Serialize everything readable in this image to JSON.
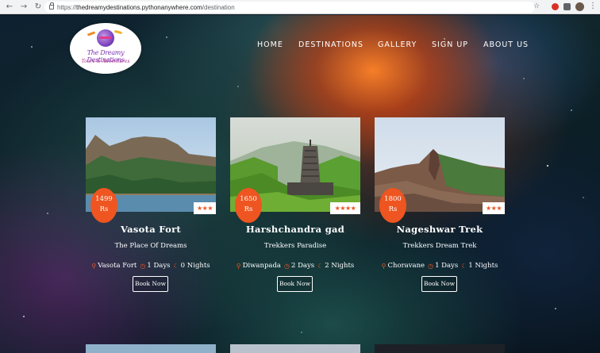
{
  "browser": {
    "url_prefix": "https://",
    "url_host": "thedreamydestinations.pythonanywhere.com",
    "url_path": "/destination"
  },
  "logo": {
    "title": "The Dreamy Destinations",
    "subtitle": "Tours & Adventures"
  },
  "nav": {
    "home": "HOME",
    "destinations": "DESTINATIONS",
    "gallery": "GALLERY",
    "signup": "SIGN UP",
    "about": "ABOUT US"
  },
  "cards": [
    {
      "title": "Vasota Fort",
      "subtitle": "The Place Of Dreams",
      "price_amount": "1499",
      "price_unit": "Rs",
      "stars": "★★★",
      "location": "Vasota Fort",
      "days": "1 Days",
      "nights": "0 Nights",
      "button": "Book Now"
    },
    {
      "title": "Harshchandra gad",
      "subtitle": "Trekkers Paradise",
      "price_amount": "1650",
      "price_unit": "Rs",
      "stars": "★★★★",
      "location": "Diwanpada",
      "days": "2 Days",
      "nights": "2 Nights",
      "button": "Book Now"
    },
    {
      "title": "Nageshwar Trek",
      "subtitle": "Trekkers Dream Trek",
      "price_amount": "1800",
      "price_unit": "Rs",
      "stars": "★★★",
      "location": "Choravane",
      "days": "1 Days",
      "nights": "1 Nights",
      "button": "Book Now"
    }
  ],
  "icons": {
    "location": "map-pin-icon",
    "days": "clock-icon",
    "nights": "moon-icon"
  },
  "colors": {
    "accent": "#ee5520",
    "nav_text": "#ffffff"
  }
}
